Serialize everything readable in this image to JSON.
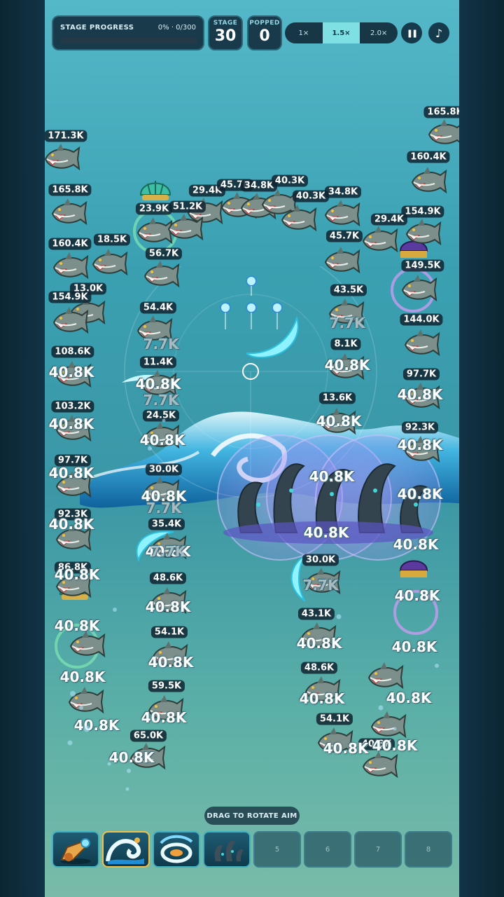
{
  "hud": {
    "progress_title": "STAGE PROGRESS",
    "progress_value": "0% · 0/300",
    "progress_fraction": 0,
    "stage_label": "STAGE",
    "stage_value": "30",
    "popped_label": "POPPED",
    "popped_value": "0",
    "speeds": [
      "1×",
      "1.5×",
      "2.0×"
    ],
    "speed_selected": "1.5×",
    "pause_glyph": "❚❚",
    "music_glyph": "♪"
  },
  "hp_labels": [
    "165.8K",
    "171.3K",
    "160.4K",
    "165.8K",
    "29.4K",
    "45.7K",
    "34.8K",
    "40.3K",
    "40.3K",
    "34.8K",
    "23.9K",
    "51.2K",
    "154.9K",
    "29.4K",
    "18.5K",
    "160.4K",
    "45.7K",
    "149.5K",
    "56.7K",
    "13.0K",
    "154.9K",
    "43.5K",
    "54.4K",
    "144.0K",
    "8.1K",
    "108.6K",
    "11.4K",
    "97.7K",
    "13.6K",
    "103.2K",
    "24.5K",
    "92.3K",
    "97.7K",
    "30.0K",
    "92.3K",
    "35.4K",
    "86.8K",
    "30.0K",
    "48.6K",
    "43.1K",
    "54.1K",
    "48.6K",
    "59.5K",
    "54.1K",
    "65.0K",
    "40.8K"
  ],
  "damage_texts": [
    "40.8K",
    "7.7K"
  ],
  "hint": "DRAG TO ROTATE AIM",
  "hotbar": {
    "slots": [
      "1",
      "2",
      "3",
      "4",
      "5",
      "6",
      "7",
      "8"
    ],
    "empty_labels": [
      "5",
      "6",
      "7",
      "8"
    ],
    "filled_icons": [
      "cannon-icon",
      "wave-icon",
      "whirlpool-icon",
      "kraken-icon"
    ]
  },
  "colors": {
    "water_top": "#55b8c9",
    "water_bottom": "#79bba8",
    "hp_tag": "#102430",
    "speed_active": "#7ee0e3",
    "ring_green": "#7de3b2",
    "ring_purple": "#c79cf0",
    "slot_selected": "#f0c04a"
  }
}
